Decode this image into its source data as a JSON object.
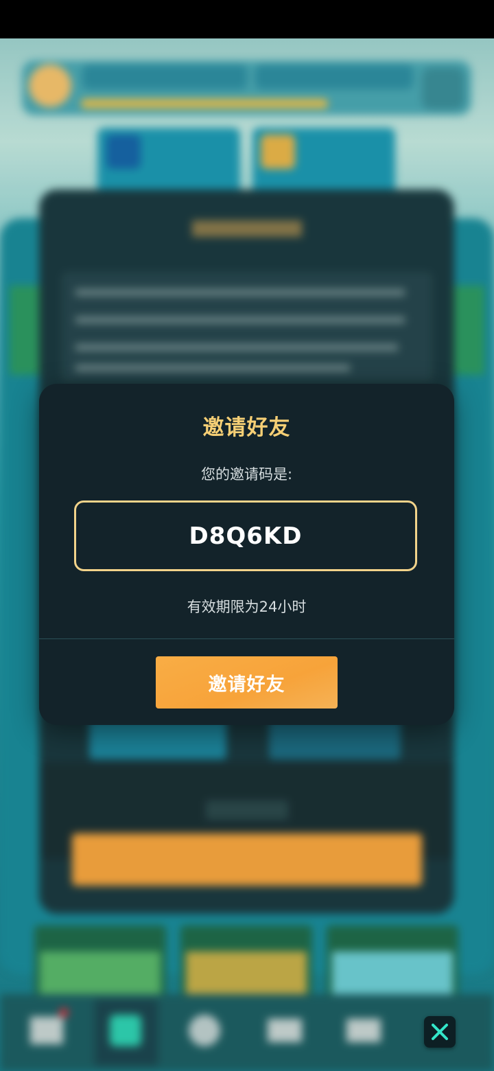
{
  "colors": {
    "modal_bg": "#13232a",
    "title_gold": "#f6cf75",
    "code_border": "#f2d38a",
    "button_orange": "#f7a33a",
    "close_accent": "#33e6c9"
  },
  "invite_modal": {
    "title": "邀请好友",
    "subtitle": "您的邀请码是:",
    "invite_code": "D8Q6KD",
    "validity": "有效期限为24小时",
    "button_label": "邀请好友"
  },
  "icons": {
    "close": "close-icon"
  }
}
